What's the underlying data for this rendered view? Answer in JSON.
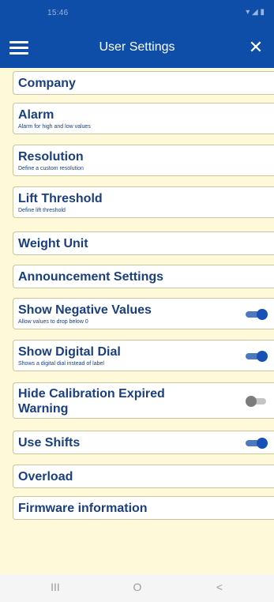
{
  "status_bar": {
    "time": "15:46",
    "icons": "▾ ◢ ▮"
  },
  "header": {
    "title": "User Settings",
    "menu_icon": "hamburger-menu-icon",
    "close_icon": "close-icon",
    "close_glyph": "✕"
  },
  "colors": {
    "header_bg": "#0f4ea8",
    "page_bg": "#fdf9d9",
    "item_text": "#1a3f80",
    "toggle_on": "#1651b5",
    "toggle_off": "#7c7c7c"
  },
  "settings": [
    {
      "title": "Company"
    },
    {
      "title": "Alarm",
      "subtitle": "Alarm for high and low values"
    },
    {
      "title": "Resolution",
      "subtitle": "Define a custom resolution"
    },
    {
      "title": "Lift Threshold",
      "subtitle": "Define lift threshold"
    },
    {
      "title": "Weight Unit"
    },
    {
      "title": "Announcement Settings"
    },
    {
      "title": "Show Negative Values",
      "subtitle": "Allow values to drop below 0",
      "toggle": true
    },
    {
      "title": "Show Digital Dial",
      "subtitle": "Shows a digital dial instead of label",
      "toggle": true
    },
    {
      "title_line1": "Hide Calibration Expired",
      "title_line2": "Warning",
      "toggle": false
    },
    {
      "title": "Use Shifts",
      "toggle": true
    },
    {
      "title": "Overload"
    },
    {
      "title": "Firmware information"
    }
  ],
  "nav_bar": {
    "recents_glyph": "III",
    "home_glyph": "O",
    "back_glyph": "<"
  }
}
